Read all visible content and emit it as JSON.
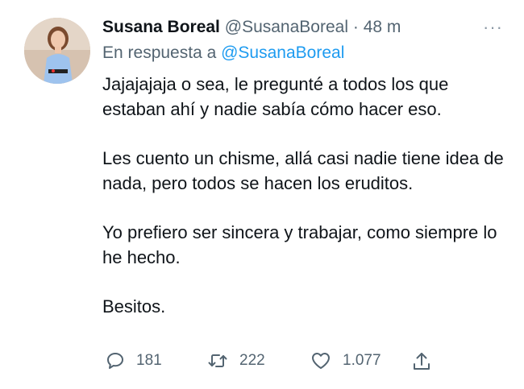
{
  "tweet": {
    "author_name": "Susana Boreal",
    "author_handle": "@SusanaBoreal",
    "separator": "·",
    "time": "48 m",
    "more_glyph": "···",
    "reply_prefix": "En respuesta a",
    "reply_to": "@SusanaBoreal",
    "paragraphs": [
      "Jajajajaja o sea, le pregunté a todos los que estaban ahí y nadie sabía cómo hacer eso.",
      "Les cuento un chisme, allá casi nadie tiene idea de nada, pero todos se hacen los eruditos.",
      "Yo prefiero ser sincera y trabajar, como siempre lo he hecho.",
      "Besitos."
    ],
    "actions": {
      "replies": "181",
      "retweets": "222",
      "likes": "1.077"
    }
  },
  "icons": {
    "reply": "speech-bubble-icon",
    "retweet": "retweet-arrows-icon",
    "like": "heart-icon",
    "share": "share-upload-icon",
    "more": "ellipsis-icon"
  },
  "colors": {
    "text": "#0f1419",
    "secondary": "#536471",
    "link": "#1d9bf0"
  }
}
